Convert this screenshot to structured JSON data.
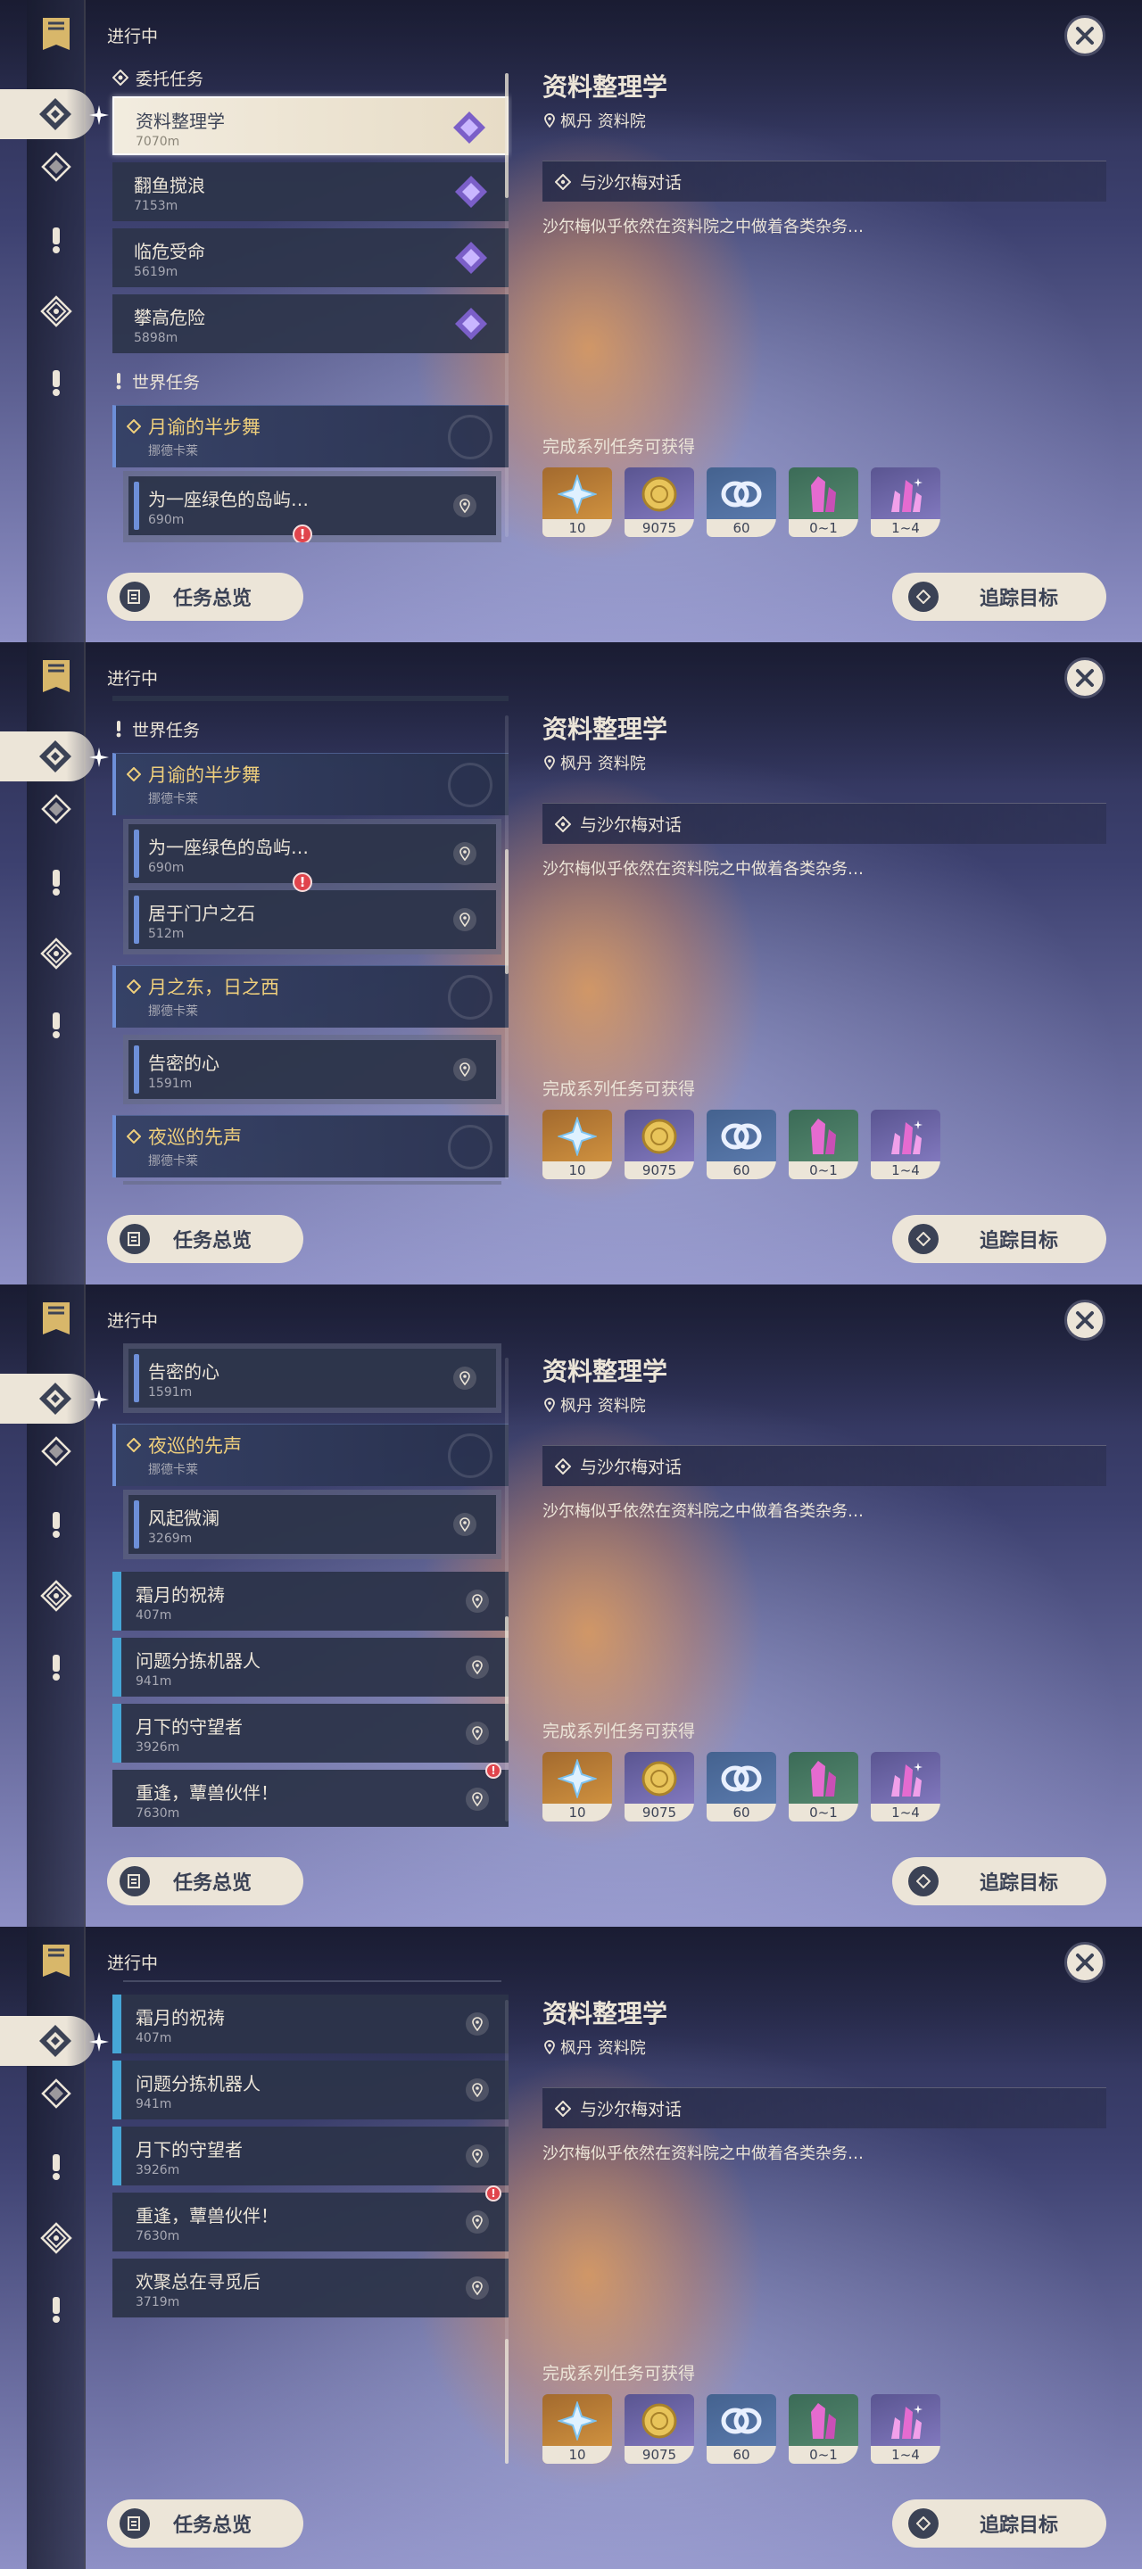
{
  "status_title": "进行中",
  "close_label": "✕",
  "categories": {
    "commission": "委托任务",
    "world": "世界任务"
  },
  "commissions": [
    {
      "name": "资料整理学",
      "dist": "7070m"
    },
    {
      "name": "翻鱼搅浪",
      "dist": "7153m"
    },
    {
      "name": "临危受命",
      "dist": "5619m"
    },
    {
      "name": "攀高危险",
      "dist": "5898m"
    }
  ],
  "world_groups": [
    {
      "name": "月谕的半步舞",
      "sub": "挪德卡莱",
      "children": [
        {
          "name": "为一座绿色的岛屿…",
          "dist": "690m"
        },
        {
          "name": "居于门户之石",
          "dist": "512m"
        }
      ]
    },
    {
      "name": "月之东，日之西",
      "sub": "挪德卡莱",
      "children": [
        {
          "name": "告密的心",
          "dist": "1591m"
        }
      ]
    },
    {
      "name": "夜巡的先声",
      "sub": "挪德卡莱",
      "children": [
        {
          "name": "风起微澜",
          "dist": "3269m"
        }
      ]
    }
  ],
  "world_quests": [
    {
      "name": "霜月的祝祷",
      "dist": "407m"
    },
    {
      "name": "问题分拣机器人",
      "dist": "941m"
    },
    {
      "name": "月下的守望者",
      "dist": "3926m"
    },
    {
      "name": "重逢，蕈兽伙伴！",
      "dist": "7630m"
    },
    {
      "name": "欢聚总在寻觅后",
      "dist": "3719m"
    }
  ],
  "alert_mark": "!",
  "detail": {
    "title": "资料整理学",
    "location": "枫丹 资料院",
    "objective": "与沙尔梅对话",
    "description": "沙尔梅似乎依然在资料院之中做着各类杂务…",
    "rewards_title": "完成系列任务可获得",
    "rewards": [
      {
        "icon": "primogem-icon",
        "count": "10",
        "bg": "#b5772f"
      },
      {
        "icon": "mora-icon",
        "count": "9075",
        "bg": "#7b74b8"
      },
      {
        "icon": "companionship-exp-icon",
        "count": "60",
        "bg": "#5a76a8"
      },
      {
        "icon": "crystal-green-icon",
        "count": "0~1",
        "bg": "#4d7f68"
      },
      {
        "icon": "crystal-purple-icon",
        "count": "1~4",
        "bg": "#7b74b8"
      }
    ]
  },
  "buttons": {
    "overview": "任务总览",
    "track": "追踪目标"
  },
  "colors": {
    "accent_gold": "#efcf7c",
    "panel_cream": "#ece5d8",
    "world_blue": "#46a6d6",
    "alert_red": "#e0444c"
  }
}
